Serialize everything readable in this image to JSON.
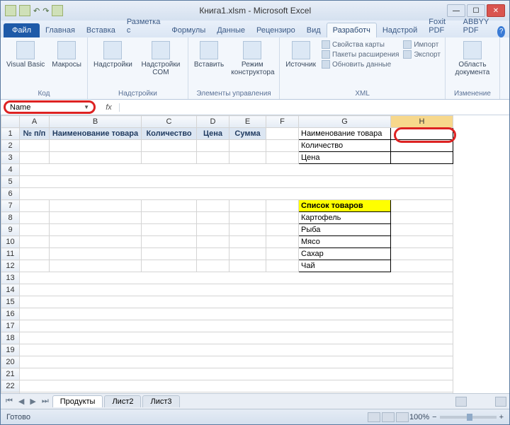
{
  "title": "Книга1.xlsm  -  Microsoft Excel",
  "tabs": {
    "file": "Файл",
    "home": "Главная",
    "insert": "Вставка",
    "layout": "Разметка с",
    "formulas": "Формулы",
    "data": "Данные",
    "review": "Рецензиро",
    "view": "Вид",
    "developer": "Разработч",
    "addins": "Надстрой",
    "foxit": "Foxit PDF",
    "abbyy": "ABBYY PDF"
  },
  "ribbon": {
    "code": {
      "label": "Код",
      "vb": "Visual\nBasic",
      "macros": "Макросы"
    },
    "addins": {
      "label": "Надстройки",
      "addins": "Надстройки",
      "com": "Надстройки\nCOM"
    },
    "controls": {
      "label": "Элементы управления",
      "insert": "Вставить",
      "design": "Режим\nконструктора"
    },
    "xml": {
      "label": "XML",
      "source": "Источник",
      "mapprops": "Свойства карты",
      "expansion": "Пакеты расширения",
      "refresh": "Обновить данные",
      "import": "Импорт",
      "export": "Экспорт"
    },
    "modify": {
      "label": "Изменение",
      "docpanel": "Область\nдокумента"
    }
  },
  "name_box": "Name",
  "fx_label": "fx",
  "columns": [
    "A",
    "B",
    "C",
    "D",
    "E",
    "F",
    "G",
    "H"
  ],
  "headers": {
    "a1": "№ п/п",
    "b1": "Наименование товара",
    "c1": "Количество",
    "d1": "Цена",
    "e1": "Сумма"
  },
  "side_labels": {
    "g1": "Наименование товара",
    "g2": "Количество",
    "g3": "Цена"
  },
  "list_header": "Список товаров",
  "list_items": [
    "Картофель",
    "Рыба",
    "Мясо",
    "Сахар",
    "Чай"
  ],
  "sheets": {
    "s1": "Продукты",
    "s2": "Лист2",
    "s3": "Лист3"
  },
  "status": {
    "ready": "Готово",
    "zoom": "100%"
  }
}
